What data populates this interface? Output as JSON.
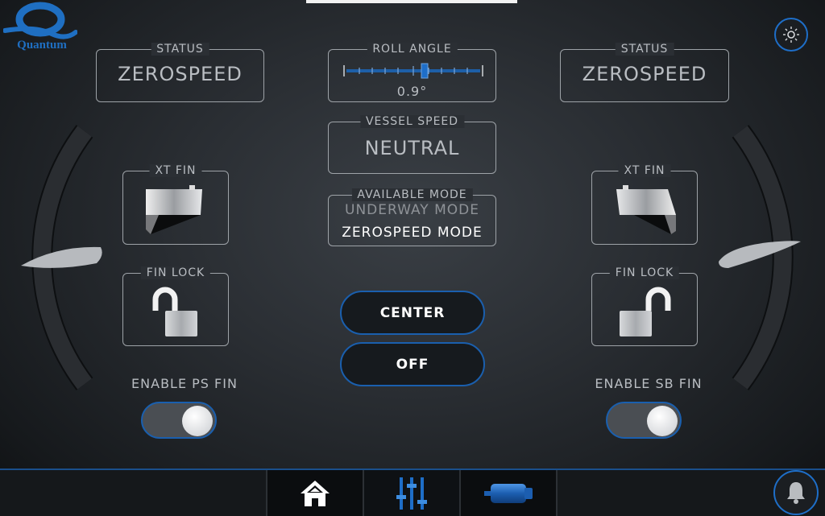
{
  "brand": {
    "name": "Quantum"
  },
  "left": {
    "status": {
      "label": "STATUS",
      "value": "ZEROSPEED"
    },
    "xt_fin": {
      "label": "XT FIN"
    },
    "fin_lock": {
      "label": "FIN LOCK"
    },
    "enable": {
      "label": "ENABLE PS FIN",
      "on": true
    }
  },
  "right": {
    "status": {
      "label": "STATUS",
      "value": "ZEROSPEED"
    },
    "xt_fin": {
      "label": "XT FIN"
    },
    "fin_lock": {
      "label": "FIN LOCK"
    },
    "enable": {
      "label": "ENABLE SB FIN",
      "on": true
    }
  },
  "center": {
    "roll_angle": {
      "label": "ROLL ANGLE",
      "value": "0.9°"
    },
    "vessel_speed": {
      "label": "VESSEL SPEED",
      "value": "NEUTRAL"
    },
    "available_mode": {
      "label": "AVAILABLE MODE",
      "options": [
        "UNDERWAY MODE",
        "ZEROSPEED MODE"
      ],
      "selected": "ZEROSPEED MODE"
    },
    "center_button": "CENTER",
    "off_button": "OFF"
  },
  "icons": {
    "brightness": "sun-icon",
    "alarm": "bell-icon",
    "home": "home-icon",
    "settings": "sliders-icon",
    "stabilizer": "cylinder-icon"
  },
  "colors": {
    "accent": "#1e6ec8",
    "text": "#b9bdc2",
    "active_text": "#ffffff"
  }
}
